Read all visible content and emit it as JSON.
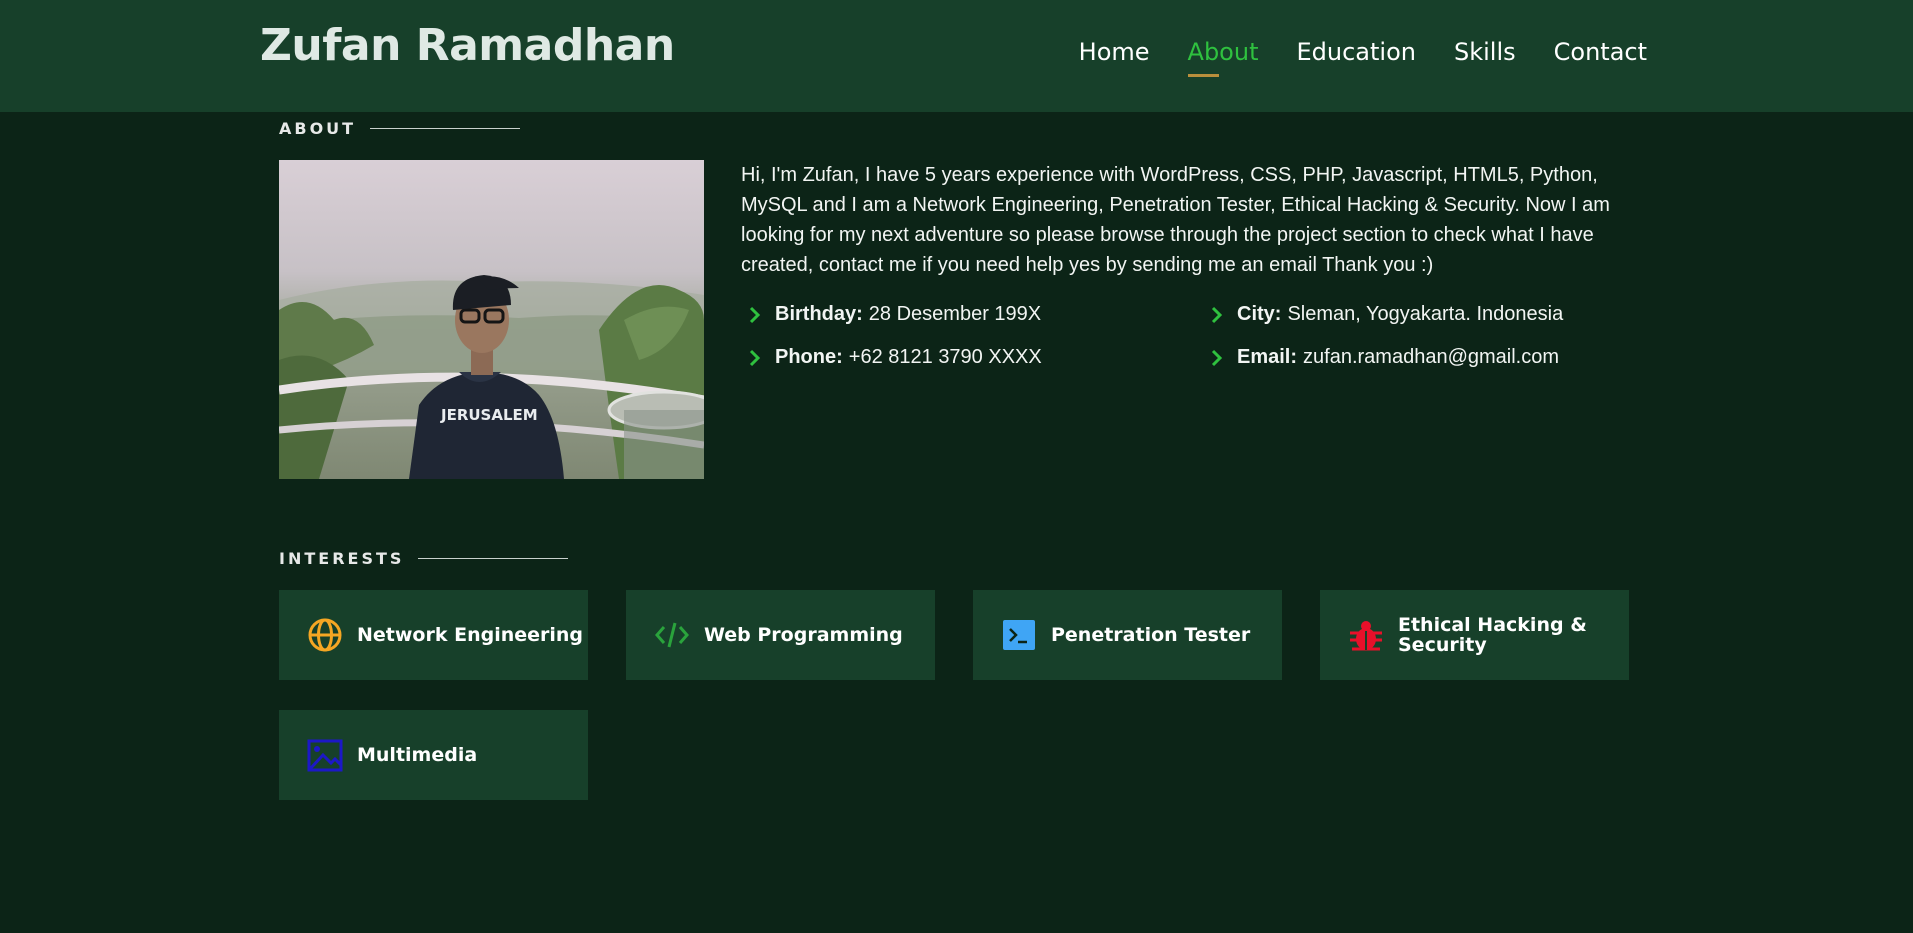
{
  "header": {
    "brand": "Zufan Ramadhan",
    "nav": [
      {
        "label": "Home",
        "active": false
      },
      {
        "label": "About",
        "active": true
      },
      {
        "label": "Education",
        "active": false
      },
      {
        "label": "Skills",
        "active": false
      },
      {
        "label": "Contact",
        "active": false
      }
    ]
  },
  "about": {
    "section_title": "ABOUT",
    "bio": "Hi, I'm Zufan, I have 5 years experience with WordPress, CSS, PHP, Javascript, HTML5, Python, MySQL and I am a Network Engineering, Penetration Tester, Ethical Hacking & Security. Now I am looking for my next adventure so please browse through the project section to check what I have created, contact me if you need help yes by sending me an email Thank you :)",
    "photo_shirt_text": "JERUSALEM",
    "facts": [
      {
        "label": "Birthday:",
        "value": "28 Desember 199X"
      },
      {
        "label": "City:",
        "value": "Sleman, Yogyakarta. Indonesia"
      },
      {
        "label": "Phone:",
        "value": "+62 8121 3790 XXXX"
      },
      {
        "label": "Email:",
        "value": "zufan.ramadhan@gmail.com"
      }
    ]
  },
  "interests": {
    "section_title": "INTERESTS",
    "items": [
      {
        "label": "Network Engineering",
        "icon": "globe-icon",
        "color": "#f5a623"
      },
      {
        "label": "Web Programming",
        "icon": "code-icon",
        "color": "#2aa33c"
      },
      {
        "label": "Penetration Tester",
        "icon": "terminal-icon",
        "color": "#3fa5f5"
      },
      {
        "label": "Ethical Hacking & Security",
        "icon": "bug-icon",
        "color": "#e8102a"
      },
      {
        "label": "Multimedia",
        "icon": "image-icon",
        "color": "#1c18c8"
      }
    ]
  },
  "colors": {
    "header_bg": "#17402a",
    "page_bg": "#0c2417",
    "accent": "#2fc13f",
    "nav_underline": "#b98f3c"
  }
}
